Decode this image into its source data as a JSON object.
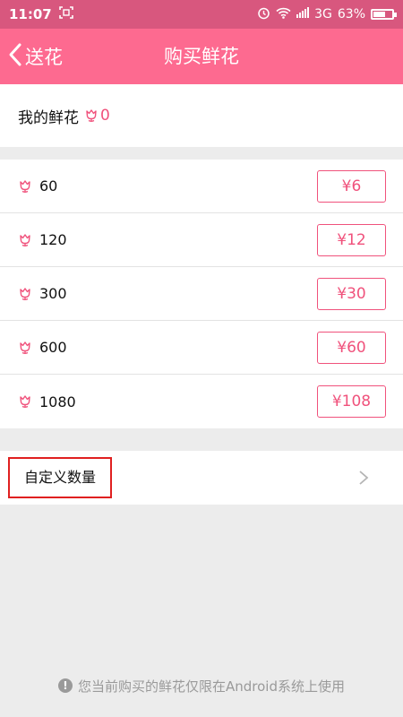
{
  "status_bar": {
    "time": "11:07",
    "network": "3G",
    "battery_percent": "63%",
    "battery_level": 0.63
  },
  "header": {
    "back_label": "送花",
    "title": "购买鲜花"
  },
  "my_flowers": {
    "label": "我的鲜花",
    "count": "0"
  },
  "packages": [
    {
      "amount": "60",
      "price": "¥6"
    },
    {
      "amount": "120",
      "price": "¥12"
    },
    {
      "amount": "300",
      "price": "¥30"
    },
    {
      "amount": "600",
      "price": "¥60"
    },
    {
      "amount": "1080",
      "price": "¥108"
    }
  ],
  "custom": {
    "label": "自定义数量"
  },
  "footer": {
    "notice": "您当前购买的鲜花仅限在Android系统上使用"
  },
  "colors": {
    "header": "#fd6a90",
    "status_bar": "#d8577e",
    "accent": "#f0527c",
    "highlight": "#e02020"
  }
}
